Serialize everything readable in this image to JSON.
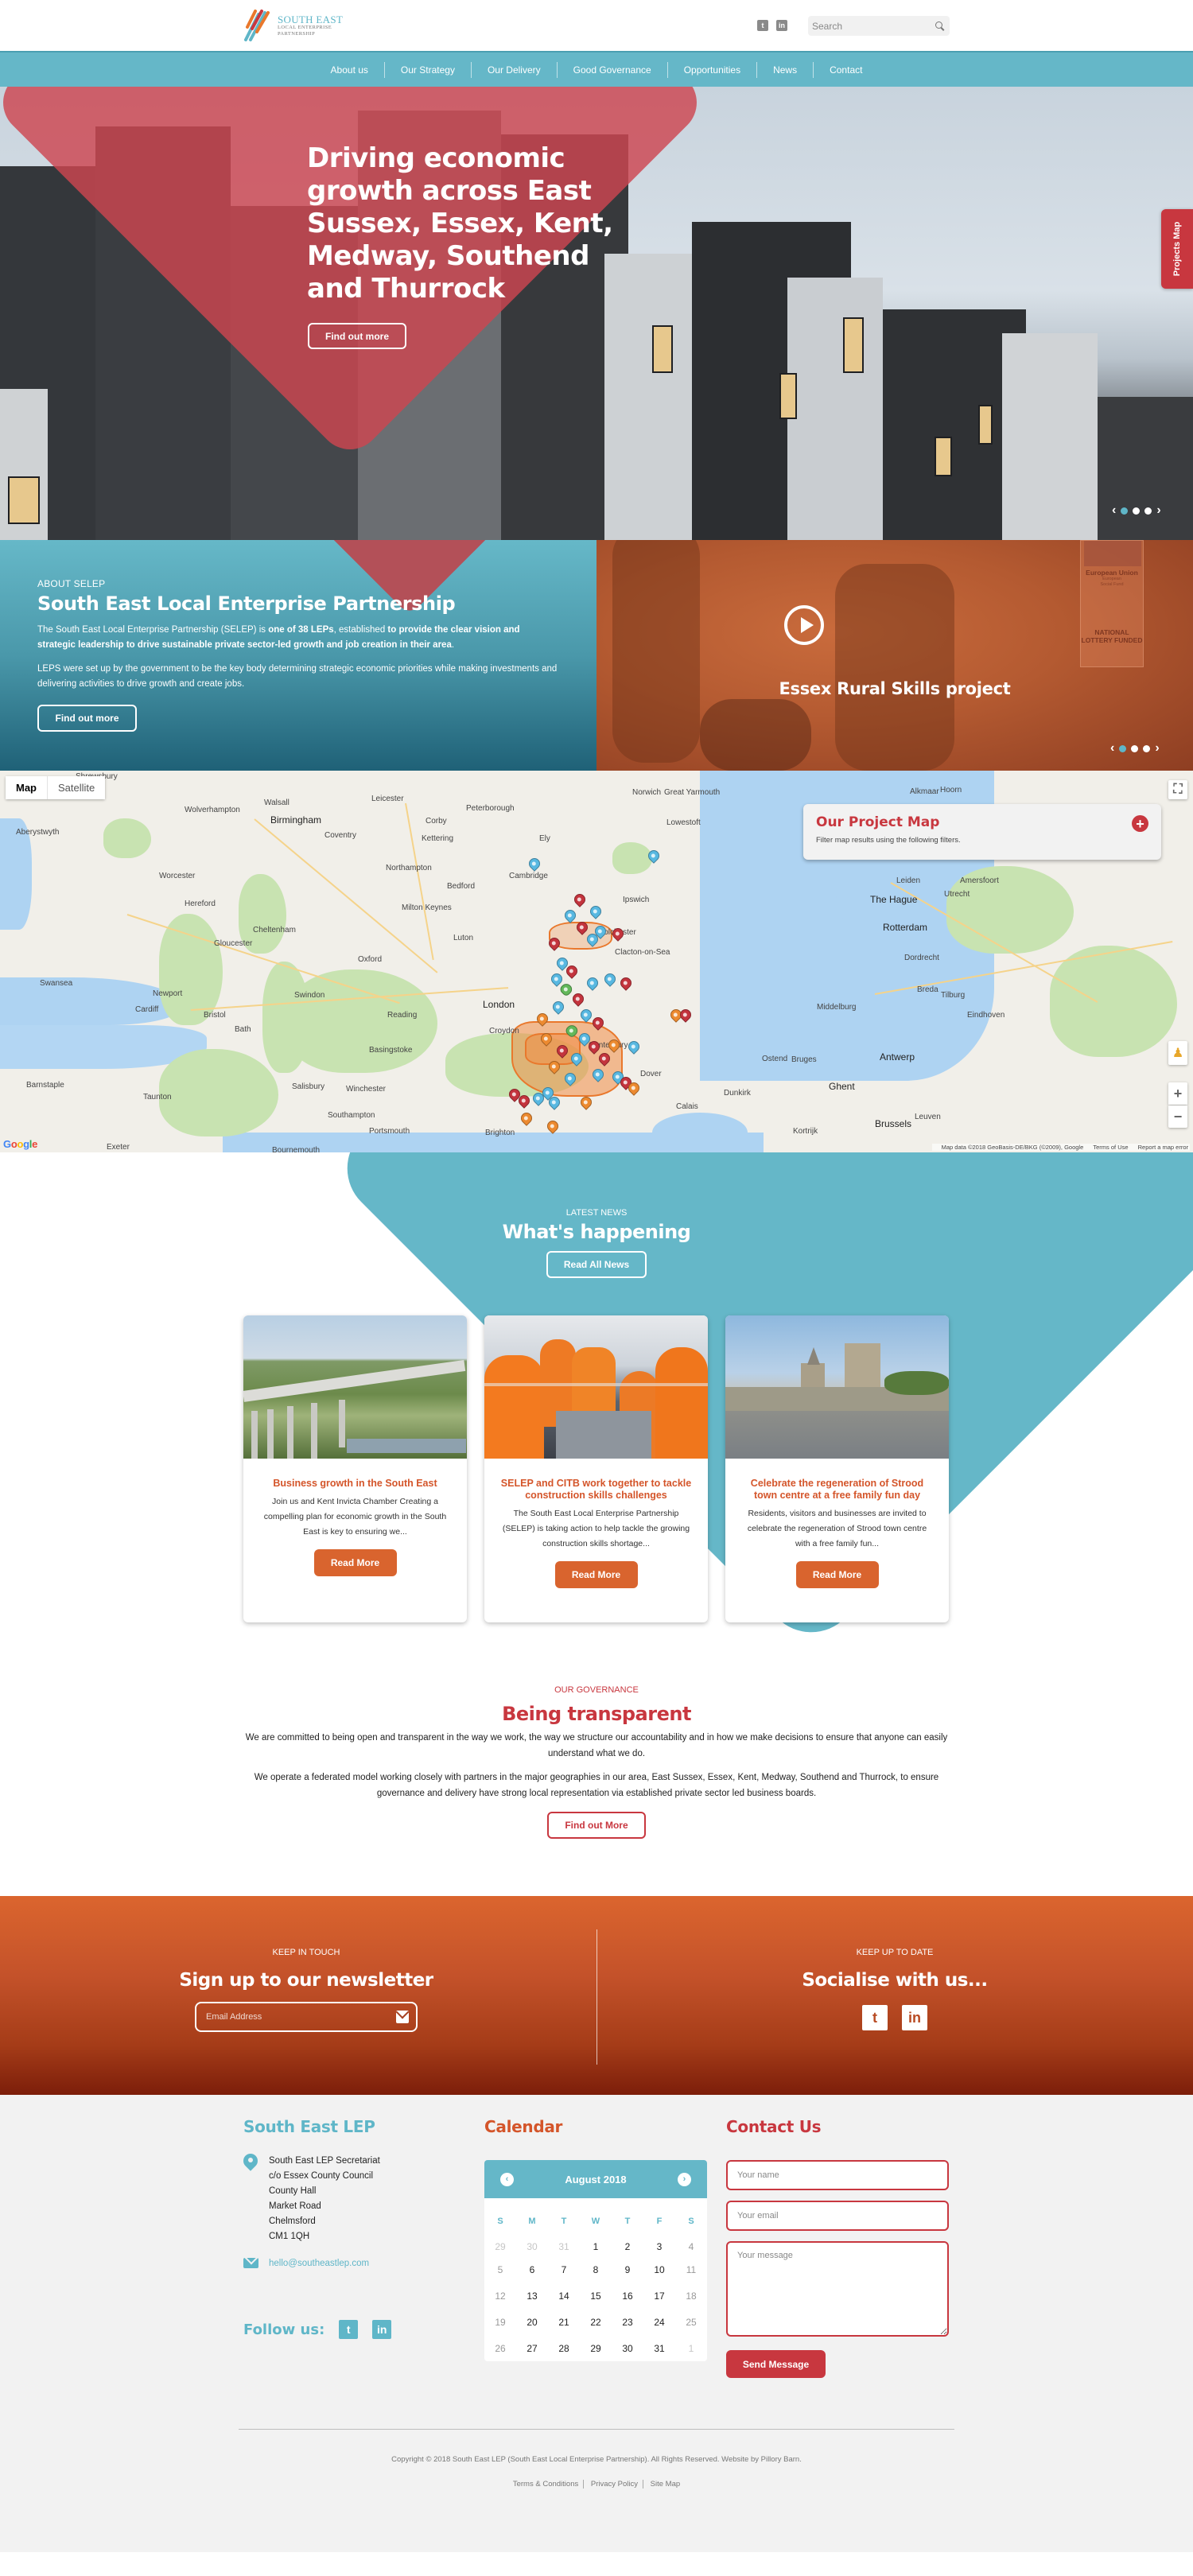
{
  "header": {
    "logo": {
      "line1": "SOUTH EAST",
      "line2": "LOCAL ENTERPRISE",
      "line3": "PARTNERSHIP"
    },
    "social": [
      {
        "icon": "twitter-icon",
        "glyph": "t"
      },
      {
        "icon": "linkedin-icon",
        "glyph": "in"
      }
    ],
    "search": {
      "placeholder": "Search",
      "value": ""
    }
  },
  "nav": {
    "items": [
      "About us",
      "Our Strategy",
      "Our Delivery",
      "Good Governance",
      "Opportunities",
      "News",
      "Contact"
    ]
  },
  "hero": {
    "title": "Driving economic growth across East Sussex, Essex, Kent, Medway, Southend and Thurrock",
    "button": "Find out more",
    "projects_tab": "Projects Map",
    "carousel": {
      "slides": 3,
      "active": 1,
      "prev": "‹",
      "next": "›"
    }
  },
  "about": {
    "eyebrow": "ABOUT SELEP",
    "title": "South East Local Enterprise Partnership",
    "p1_parts": [
      {
        "text": "The South East Local Enterprise Partnership (SELEP) is ",
        "bold": false
      },
      {
        "text": "one of 38 LEPs",
        "bold": true
      },
      {
        "text": ", established ",
        "bold": false
      },
      {
        "text": "to provide the clear vision and strategic leadership to drive sustainable private sector-led growth and job creation in their area",
        "bold": true
      },
      {
        "text": ".",
        "bold": false
      }
    ],
    "p2": "LEPS were set up by the government to be the key body determining strategic economic priorities while making investments and delivering activities to drive growth and create jobs.",
    "button": "Find out more"
  },
  "video": {
    "title": "Essex Rural Skills project",
    "badge": {
      "eu": "European Union",
      "esf1": "European",
      "esf2": "Social Fund",
      "lottery1": "NATIONAL",
      "lottery2": "LOTTERY FUNDED"
    },
    "carousel": {
      "slides": 3,
      "active": 1,
      "prev": "‹",
      "next": "›"
    }
  },
  "map": {
    "type_buttons": [
      "Map",
      "Satellite"
    ],
    "active_type": "Map",
    "panel": {
      "title": "Our Project Map",
      "subtitle": "Filter map results using the following filters.",
      "toggle": "+"
    },
    "cities": [
      {
        "name": "Shrewsbury"
      },
      {
        "name": "Leicester"
      },
      {
        "name": "Peterborough"
      },
      {
        "name": "Walsall"
      },
      {
        "name": "Wolverhampton"
      },
      {
        "name": "Birmingham",
        "big": true
      },
      {
        "name": "Coventry"
      },
      {
        "name": "Corby"
      },
      {
        "name": "Kettering"
      },
      {
        "name": "Ely"
      },
      {
        "name": "Aberystwyth"
      },
      {
        "name": "Northampton"
      },
      {
        "name": "Cambridge"
      },
      {
        "name": "Worcester"
      },
      {
        "name": "Bedford"
      },
      {
        "name": "Hereford"
      },
      {
        "name": "Milton Keynes"
      },
      {
        "name": "Cheltenham"
      },
      {
        "name": "Gloucester"
      },
      {
        "name": "Luton"
      },
      {
        "name": "Oxford"
      },
      {
        "name": "Swansea"
      },
      {
        "name": "Newport"
      },
      {
        "name": "Cardiff"
      },
      {
        "name": "Swindon"
      },
      {
        "name": "London",
        "big": true
      },
      {
        "name": "Bristol"
      },
      {
        "name": "Reading"
      },
      {
        "name": "Bath"
      },
      {
        "name": "Croydon"
      },
      {
        "name": "Basingstoke"
      },
      {
        "name": "Barnstaple"
      },
      {
        "name": "Taunton"
      },
      {
        "name": "Salisbury"
      },
      {
        "name": "Winchester"
      },
      {
        "name": "Southampton"
      },
      {
        "name": "Brighton"
      },
      {
        "name": "Portsmouth"
      },
      {
        "name": "Exeter"
      },
      {
        "name": "Bournemouth"
      },
      {
        "name": "Norwich"
      },
      {
        "name": "Great Yarmouth"
      },
      {
        "name": "Lowestoft"
      },
      {
        "name": "Ipswich"
      },
      {
        "name": "Colchester"
      },
      {
        "name": "Clacton-on-Sea"
      },
      {
        "name": "Canterbury"
      },
      {
        "name": "Dover"
      },
      {
        "name": "Calais"
      },
      {
        "name": "Dunkirk"
      },
      {
        "name": "Ostend"
      },
      {
        "name": "Bruges"
      },
      {
        "name": "Ghent",
        "big": true
      },
      {
        "name": "Antwerp",
        "big": true
      },
      {
        "name": "Brussels",
        "big": true
      },
      {
        "name": "The Hague",
        "big": true
      },
      {
        "name": "Rotterdam",
        "big": true
      },
      {
        "name": "Leiden"
      },
      {
        "name": "Utrecht"
      },
      {
        "name": "Amersfoort"
      },
      {
        "name": "Dordrecht"
      },
      {
        "name": "Breda"
      },
      {
        "name": "Tilburg"
      },
      {
        "name": "Eindhoven"
      },
      {
        "name": "Middelburg"
      },
      {
        "name": "Alkmaar"
      },
      {
        "name": "Hoorn"
      },
      {
        "name": "Kortrijk"
      },
      {
        "name": "Leuven"
      }
    ],
    "zoom_in": "+",
    "zoom_out": "−",
    "google": "Google",
    "attribution": "Map data ©2018 GeoBasis-DE/BKG (©2009), Google",
    "terms": "Terms of Use",
    "report": "Report a map error"
  },
  "news": {
    "eyebrow": "LATEST NEWS",
    "title": "What's happening",
    "button": "Read All News",
    "cards": [
      {
        "title": "Business growth in the South East",
        "excerpt": "Join us and Kent Invicta Chamber Creating a compelling plan for economic growth in the South East is key to ensuring we...",
        "button": "Read More"
      },
      {
        "title": "SELEP and CITB work together to tackle construction skills challenges",
        "excerpt": "The South East Local Enterprise Partnership (SELEP) is taking action to help tackle the growing construction skills shortage...",
        "button": "Read More"
      },
      {
        "title": "Celebrate the regeneration of Strood town centre at a free family fun day",
        "excerpt": "Residents, visitors and businesses are invited to celebrate the regeneration of Strood town centre with a free family fun...",
        "button": "Read More"
      }
    ]
  },
  "governance": {
    "eyebrow": "OUR GOVERNANCE",
    "title": "Being transparent",
    "p1": "We are committed to being open and transparent in the way we work, the way we structure our accountability and in how we make decisions to ensure that anyone can easily understand what we do.",
    "p2": "We operate a federated model working closely with partners in the major geographies in our area, East Sussex, Essex, Kent, Medway, Southend and Thurrock, to ensure governance and delivery have strong local representation via established private sector led business boards.",
    "button": "Find out More"
  },
  "newsletter": {
    "left": {
      "eyebrow": "KEEP IN TOUCH",
      "title": "Sign up to our newsletter",
      "placeholder": "Email Address"
    },
    "right": {
      "eyebrow": "KEEP UP TO DATE",
      "title": "Socialise with us..."
    }
  },
  "footer": {
    "org": {
      "title": "South East LEP",
      "address": [
        "South East LEP Secretariat",
        "c/o Essex County Council",
        "County Hall",
        "Market Road",
        "Chelmsford",
        "CM1 1QH"
      ],
      "email": "hello@southeastlep.com",
      "follow_label": "Follow us:"
    },
    "calendar": {
      "title": "Calendar",
      "month": "August 2018",
      "prev": "‹",
      "next": "›",
      "weekdays": [
        "S",
        "M",
        "T",
        "W",
        "T",
        "F",
        "S"
      ],
      "weeks": [
        [
          {
            "d": "29",
            "m": true
          },
          {
            "d": "30",
            "m": true
          },
          {
            "d": "31",
            "m": true
          },
          {
            "d": "1"
          },
          {
            "d": "2"
          },
          {
            "d": "3"
          },
          {
            "d": "4",
            "w": true
          }
        ],
        [
          {
            "d": "5",
            "w": true
          },
          {
            "d": "6"
          },
          {
            "d": "7"
          },
          {
            "d": "8"
          },
          {
            "d": "9"
          },
          {
            "d": "10"
          },
          {
            "d": "11",
            "w": true
          }
        ],
        [
          {
            "d": "12",
            "w": true
          },
          {
            "d": "13"
          },
          {
            "d": "14"
          },
          {
            "d": "15"
          },
          {
            "d": "16"
          },
          {
            "d": "17"
          },
          {
            "d": "18",
            "w": true
          }
        ],
        [
          {
            "d": "19",
            "w": true
          },
          {
            "d": "20"
          },
          {
            "d": "21"
          },
          {
            "d": "22"
          },
          {
            "d": "23"
          },
          {
            "d": "24"
          },
          {
            "d": "25",
            "w": true
          }
        ],
        [
          {
            "d": "26",
            "w": true
          },
          {
            "d": "27"
          },
          {
            "d": "28"
          },
          {
            "d": "29"
          },
          {
            "d": "30"
          },
          {
            "d": "31"
          },
          {
            "d": "1",
            "m": true
          }
        ]
      ]
    },
    "contact": {
      "title": "Contact Us",
      "name_placeholder": "Your name",
      "email_placeholder": "Your email",
      "message_placeholder": "Your message",
      "button": "Send Message"
    },
    "copyright": "Copyright © 2018 South East LEP (South East Local Enterprise Partnership). All Rights Reserved. Website by Pillory Barn.",
    "links": [
      "Terms & Conditions",
      "Privacy Policy",
      "Site Map"
    ]
  },
  "colors": {
    "teal": "#65b7c8",
    "red": "#c8373f",
    "orange": "#d9642e",
    "footer_bg": "#f2f2f2"
  }
}
